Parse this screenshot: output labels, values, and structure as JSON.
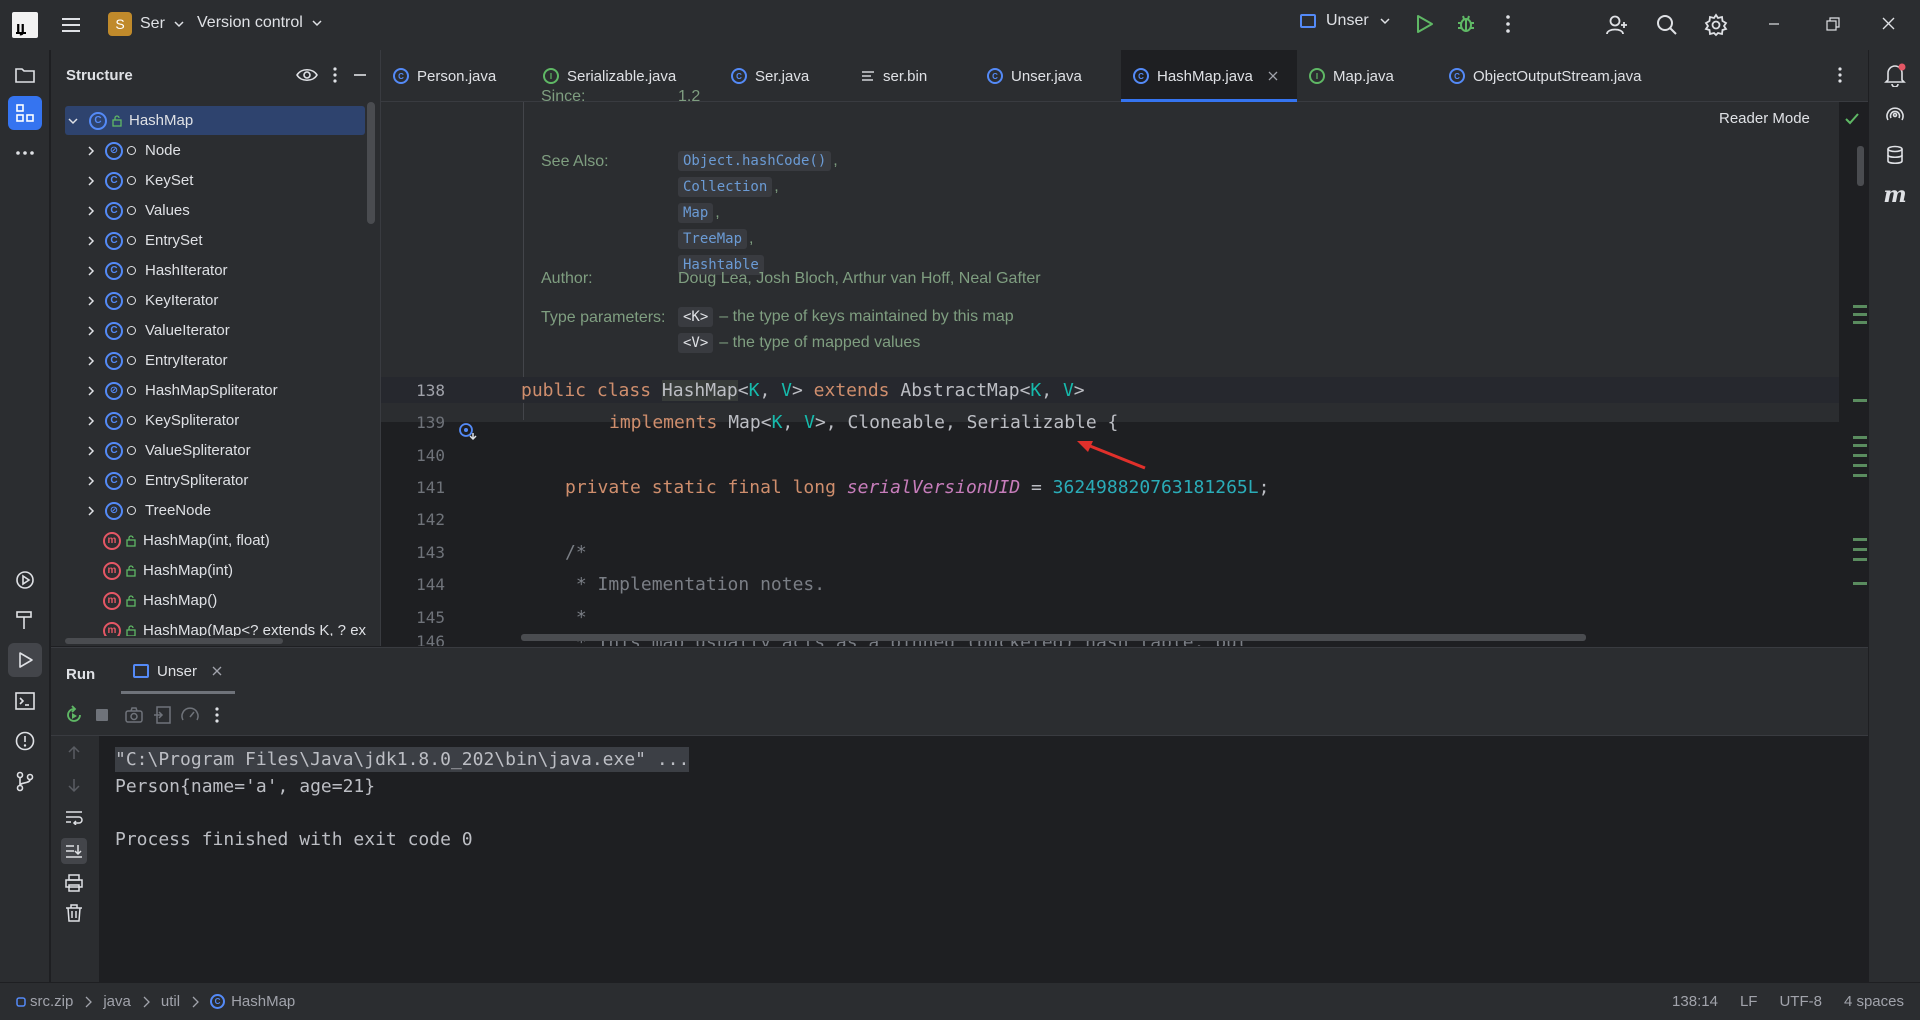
{
  "titlebar": {
    "project_initial": "S",
    "project_name": "Ser",
    "vcs_label": "Version control",
    "run_config": "Unser"
  },
  "structure": {
    "title": "Structure",
    "items": [
      {
        "label": "HashMap",
        "kind": "class",
        "expanded": true,
        "selected": true
      },
      {
        "label": "Node",
        "kind": "inner-class"
      },
      {
        "label": "KeySet",
        "kind": "inner-class"
      },
      {
        "label": "Values",
        "kind": "inner-class"
      },
      {
        "label": "EntrySet",
        "kind": "inner-class"
      },
      {
        "label": "HashIterator",
        "kind": "inner-class"
      },
      {
        "label": "KeyIterator",
        "kind": "inner-class"
      },
      {
        "label": "ValueIterator",
        "kind": "inner-class"
      },
      {
        "label": "EntryIterator",
        "kind": "inner-class"
      },
      {
        "label": "HashMapSpliterator",
        "kind": "inner-class"
      },
      {
        "label": "KeySpliterator",
        "kind": "inner-class"
      },
      {
        "label": "ValueSpliterator",
        "kind": "inner-class"
      },
      {
        "label": "EntrySpliterator",
        "kind": "inner-class"
      },
      {
        "label": "TreeNode",
        "kind": "inner-class"
      },
      {
        "label": "HashMap(int, float)",
        "kind": "method"
      },
      {
        "label": "HashMap(int)",
        "kind": "method"
      },
      {
        "label": "HashMap()",
        "kind": "method"
      },
      {
        "label": "HashMap(Map<? extends K, ? ex",
        "kind": "method"
      }
    ]
  },
  "editor": {
    "tabs": [
      {
        "label": "Person.java",
        "icon": "class-icon"
      },
      {
        "label": "Serializable.java",
        "icon": "interface-icon"
      },
      {
        "label": "Ser.java",
        "icon": "class-icon"
      },
      {
        "label": "ser.bin",
        "icon": "text-file-icon"
      },
      {
        "label": "Unser.java",
        "icon": "class-icon"
      },
      {
        "label": "HashMap.java",
        "icon": "class-icon",
        "active": true
      },
      {
        "label": "Map.java",
        "icon": "interface-icon"
      },
      {
        "label": "ObjectOutputStream.java",
        "icon": "class-icon"
      }
    ],
    "reader_mode": "Reader Mode",
    "doc": {
      "since_label": "Since:",
      "since_value": "1.2",
      "see_also_label": "See Also:",
      "see_also": [
        "Object.hashCode()",
        "Collection",
        "Map",
        "TreeMap",
        "Hashtable"
      ],
      "author_label": "Author:",
      "author_value": "Doug Lea, Josh Bloch, Arthur van Hoff, Neal Gafter",
      "type_params_label": "Type parameters:",
      "type_params": [
        {
          "name": "<K>",
          "desc": "– the type of keys maintained by this map"
        },
        {
          "name": "<V>",
          "desc": "– the type of mapped values"
        }
      ]
    },
    "lines": [
      {
        "num": "138"
      },
      {
        "num": "139"
      },
      {
        "num": "140"
      },
      {
        "num": "141"
      },
      {
        "num": "142"
      },
      {
        "num": "143"
      },
      {
        "num": "144"
      },
      {
        "num": "145"
      },
      {
        "num": "146"
      }
    ],
    "code": {
      "l138_kw1": "public class ",
      "l138_cls": "HashMap",
      "l138_a": "<",
      "l138_k": "K",
      "l138_b": ", ",
      "l138_v": "V",
      "l138_c": "> ",
      "l138_kw2": "extends ",
      "l138_d": "AbstractMap<",
      "l138_k2": "K",
      "l138_e": ", ",
      "l138_v2": "V",
      "l138_f": ">",
      "l139_kw": "implements ",
      "l139_a": "Map<",
      "l139_k": "K",
      "l139_b": ", ",
      "l139_v": "V",
      "l139_c": ">, Cloneable, Serializable {",
      "l141_kw": "private static final long ",
      "l141_fld": "serialVersionUID",
      "l141_eq": " = ",
      "l141_num": "362498820763181265L",
      "l141_end": ";",
      "l143": "/*",
      "l144": " * Implementation notes.",
      "l145": " *",
      "l146": " * This map usually acts as a binned (bucketed) hash table, but"
    }
  },
  "run": {
    "title": "Run",
    "tab_label": "Unser",
    "console": [
      "\"C:\\Program Files\\Java\\jdk1.8.0_202\\bin\\java.exe\" ...",
      "Person{name='a', age=21}",
      "",
      "Process finished with exit code 0"
    ]
  },
  "statusbar": {
    "crumbs": [
      "src.zip",
      "java",
      "util",
      "HashMap"
    ],
    "position": "138:14",
    "line_sep": "LF",
    "encoding": "UTF-8",
    "indent": "4 spaces"
  },
  "colors": {
    "accent": "#3574f0",
    "keyword": "#cf8e6d",
    "type_param": "#16baac",
    "field": "#c77dbb",
    "number": "#2aacb8",
    "annotation_arrow": "#e0302b"
  }
}
